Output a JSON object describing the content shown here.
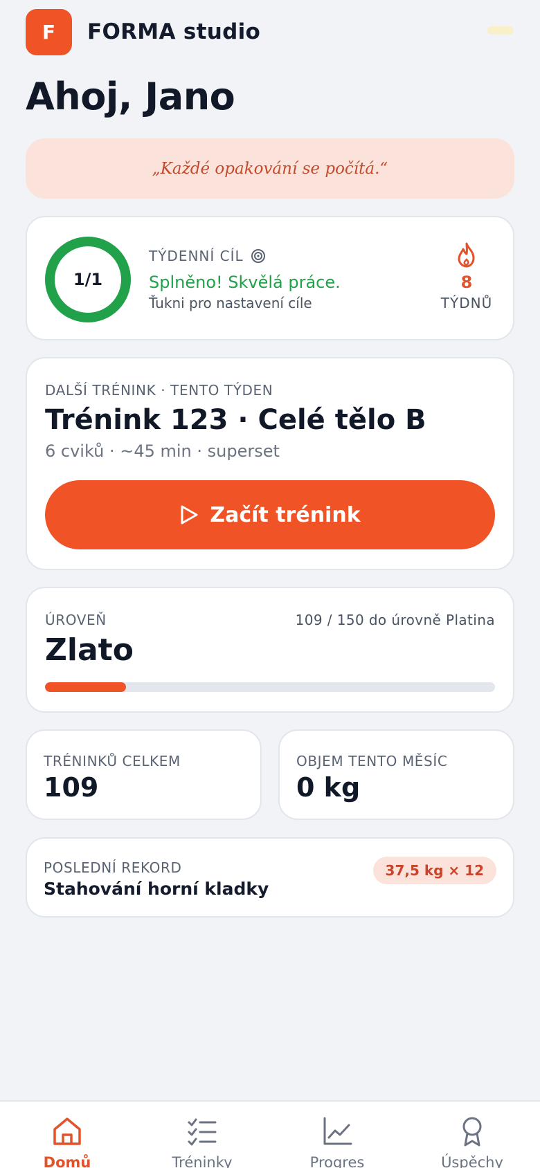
{
  "header": {
    "logo_letter": "F",
    "brand": "FORMA studio"
  },
  "greeting": "Ahoj, Jano",
  "quote": "„Každé opakování se počítá.“",
  "weekly_goal": {
    "progress_text": "1/1",
    "progress_fraction": 1.0,
    "label": "TÝDENNÍ CÍL",
    "status": "Splněno! Skvělá práce.",
    "hint": "Ťukni pro nastavení cíle",
    "streak_value": "8",
    "streak_unit": "TÝDNŮ"
  },
  "next_workout": {
    "label": "DALŠÍ TRÉNINK · TENTO TÝDEN",
    "title": "Trénink 123 · Celé tělo B",
    "meta": "6 cviků · ~45 min · superset",
    "start_button": "Začít trénink"
  },
  "level": {
    "label": "ÚROVEŇ",
    "progress_text": "109 / 150 do úrovně Platina",
    "name": "Zlato",
    "progress_fraction": 0.18
  },
  "stats": {
    "total_label": "TRÉNINKŮ CELKEM",
    "total_value": "109",
    "volume_label": "OBJEM TENTO MĚSÍC",
    "volume_value": "0 kg"
  },
  "record": {
    "label": "POSLEDNÍ REKORD",
    "exercise": "Stahování horní kladky",
    "badge": "37,5 kg × 12"
  },
  "nav": {
    "items": [
      {
        "label": "Domů",
        "icon": "home-icon",
        "active": true
      },
      {
        "label": "Tréninky",
        "icon": "checklist-icon",
        "active": false
      },
      {
        "label": "Progres",
        "icon": "chart-icon",
        "active": false
      },
      {
        "label": "Úspěchy",
        "icon": "award-icon",
        "active": false
      }
    ]
  },
  "colors": {
    "accent": "#f05326",
    "success": "#21a24a",
    "background": "#f1f3f7",
    "quote_bg": "#fbe3dc"
  }
}
